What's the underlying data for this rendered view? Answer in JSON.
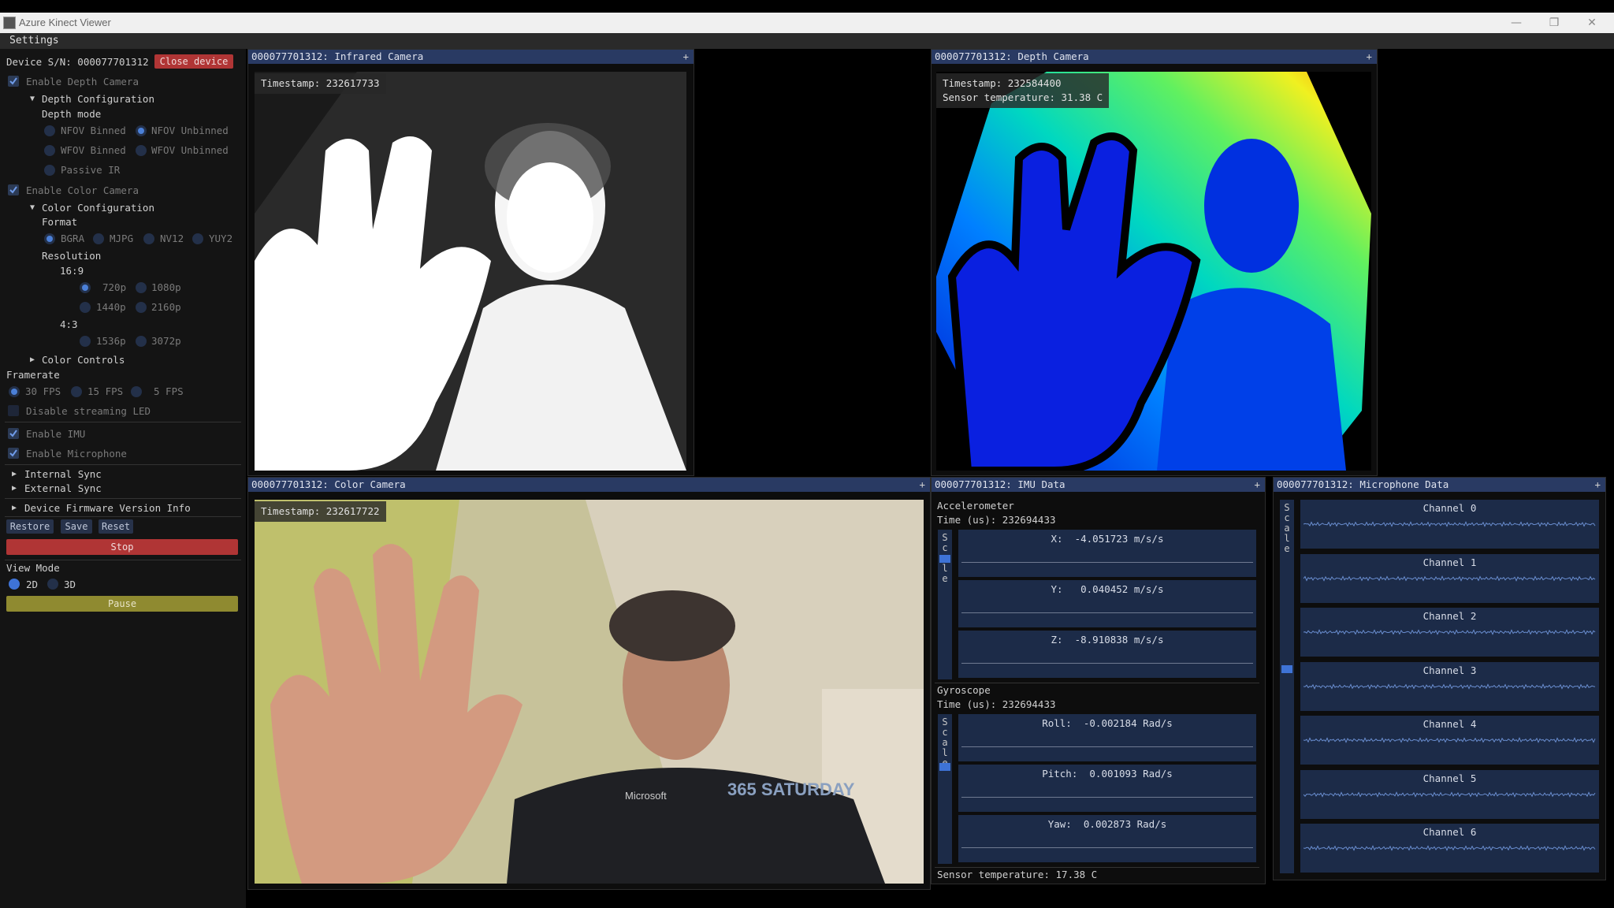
{
  "window": {
    "title": "Azure Kinect Viewer",
    "controls": [
      "—",
      "❐",
      "✕"
    ]
  },
  "menu": {
    "settings": "Settings"
  },
  "sidebar": {
    "device_sn": "Device S/N: 000077701312",
    "close_device": "Close device",
    "enable_depth": "Enable Depth Camera",
    "depth_config": "Depth Configuration",
    "depth_mode": "Depth mode",
    "depth_modes": [
      "NFOV Binned",
      "NFOV Unbinned",
      "WFOV Binned",
      "WFOV Unbinned",
      "Passive IR"
    ],
    "enable_color": "Enable Color Camera",
    "color_config": "Color Configuration",
    "format": "Format",
    "formats": [
      "BGRA",
      "MJPG",
      "NV12",
      "YUY2"
    ],
    "resolution": "Resolution",
    "ratio_169": "16:9",
    "res_169": [
      "720p",
      "1080p",
      "1440p",
      "2160p"
    ],
    "ratio_43": "4:3",
    "res_43": [
      "1536p",
      "3072p"
    ],
    "color_controls": "Color Controls",
    "framerate": "Framerate",
    "fps": [
      "30 FPS",
      "15 FPS",
      "5 FPS"
    ],
    "disable_led": "Disable streaming LED",
    "enable_imu": "Enable IMU",
    "enable_mic": "Enable Microphone",
    "internal_sync": "Internal Sync",
    "external_sync": "External Sync",
    "firmware": "Device Firmware Version Info",
    "restore": "Restore",
    "save": "Save",
    "reset": "Reset",
    "stop": "Stop",
    "view_mode": "View Mode",
    "view_2d": "2D",
    "view_3d": "3D",
    "pause": "Pause"
  },
  "ir": {
    "title": "000077701312: Infrared Camera",
    "timestamp": "Timestamp: 232617733"
  },
  "depth": {
    "title": "000077701312: Depth Camera",
    "timestamp": "Timestamp: 232584400",
    "temp": "Sensor temperature: 31.38 C"
  },
  "color": {
    "title": "000077701312: Color Camera",
    "timestamp": "Timestamp: 232617722",
    "shirt_brand": "Microsoft",
    "shirt_logo": "365 SATURDAY"
  },
  "imu": {
    "title": "000077701312: IMU Data",
    "accel_label": "Accelerometer",
    "accel_time": "Time (us): 232694433",
    "accel": [
      "X:  -4.051723 m/s/s",
      "Y:   0.040452 m/s/s",
      "Z:  -8.910838 m/s/s"
    ],
    "gyro_label": "Gyroscope",
    "gyro_time": "Time (us): 232694433",
    "gyro": [
      "Roll:  -0.002184 Rad/s",
      "Pitch:  0.001093 Rad/s",
      "Yaw:  0.002873 Rad/s"
    ],
    "scale": "Scale",
    "temp": "Sensor temperature: 17.38 C"
  },
  "mic": {
    "title": "000077701312: Microphone Data",
    "scale": "Scale",
    "channels": [
      "Channel 0",
      "Channel 1",
      "Channel 2",
      "Channel 3",
      "Channel 4",
      "Channel 5",
      "Channel 6"
    ]
  },
  "colors": {
    "panel_header": "#293a63",
    "accent": "#4b80d8",
    "stop": "#b03535",
    "pause": "#8f8a30"
  }
}
